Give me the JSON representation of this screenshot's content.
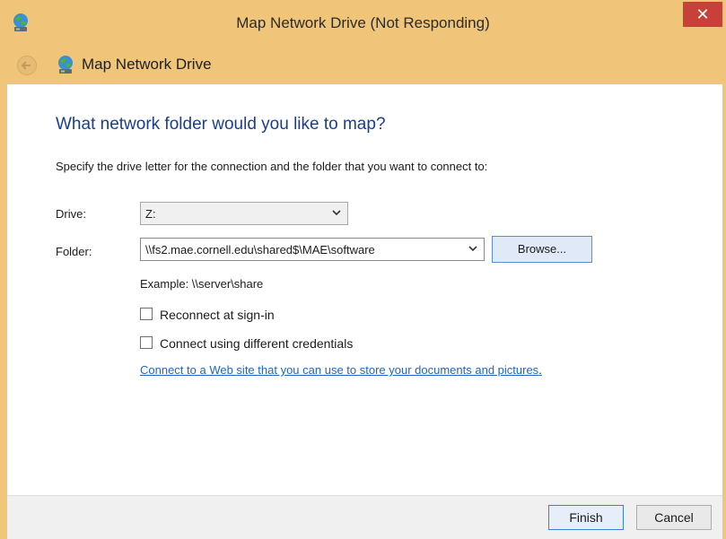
{
  "window": {
    "title": "Map Network Drive (Not Responding)",
    "close_label": "✕",
    "colors": {
      "titlebar": "#f0c579",
      "close": "#c7413a",
      "heading": "#1a3e8e",
      "link": "#2066c2"
    }
  },
  "nav": {
    "title": "Map Network Drive",
    "back_icon": "back-arrow-icon",
    "app_icon": "network-drive-icon"
  },
  "main": {
    "heading": "What network folder would you like to map?",
    "instruction": "Specify the drive letter for the connection and the folder that you want to connect to:",
    "drive": {
      "label": "Drive:",
      "value": "Z:"
    },
    "folder": {
      "label": "Folder:",
      "value": "\\\\fs2.mae.cornell.edu\\shared$\\MAE\\software"
    },
    "browse_label": "Browse...",
    "example": "Example: \\\\server\\share",
    "reconnect": {
      "label": "Reconnect at sign-in",
      "checked": false
    },
    "different_credentials": {
      "label": "Connect using different credentials",
      "checked": false
    },
    "web_link": "Connect to a Web site that you can use to store your documents and pictures",
    "web_link_suffix": "."
  },
  "footer": {
    "finish_label": "Finish",
    "cancel_label": "Cancel"
  }
}
